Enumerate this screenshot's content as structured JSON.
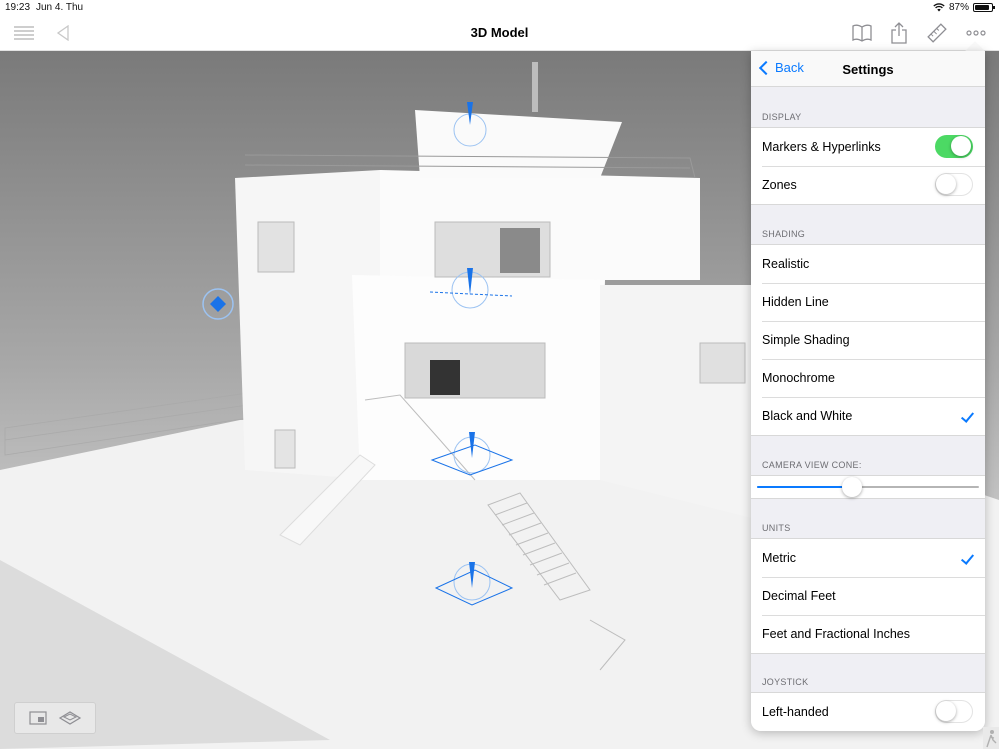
{
  "status_bar": {
    "time": "19:23",
    "date": "Jun 4. Thu",
    "battery": "87%"
  },
  "nav": {
    "title": "3D Model",
    "icons": [
      "list-icon",
      "back-arrow-icon",
      "book-icon",
      "share-icon",
      "ruler-icon",
      "more-icon"
    ]
  },
  "settings": {
    "back_label": "Back",
    "title": "Settings",
    "display": {
      "label": "DISPLAY",
      "items": [
        {
          "label": "Markers & Hyperlinks",
          "toggle": true
        },
        {
          "label": "Zones",
          "toggle": false
        }
      ]
    },
    "shading": {
      "label": "SHADING",
      "items": [
        {
          "label": "Realistic",
          "checked": false
        },
        {
          "label": "Hidden Line",
          "checked": false
        },
        {
          "label": "Simple Shading",
          "checked": false
        },
        {
          "label": "Monochrome",
          "checked": false
        },
        {
          "label": "Black and White",
          "checked": true
        }
      ]
    },
    "camera_view_cone": {
      "label": "CAMERA VIEW CONE:",
      "value": 0.43
    },
    "units": {
      "label": "UNITS",
      "items": [
        {
          "label": "Metric",
          "checked": true
        },
        {
          "label": "Decimal Feet",
          "checked": false
        },
        {
          "label": "Feet and Fractional Inches",
          "checked": false
        }
      ]
    },
    "joystick": {
      "label": "JOYSTICK",
      "items": [
        {
          "label": "Left-handed",
          "toggle": false
        }
      ]
    }
  },
  "colors": {
    "accent": "#0a7aff",
    "toggle_on": "#4cd964",
    "marker": "#1a73e8"
  }
}
